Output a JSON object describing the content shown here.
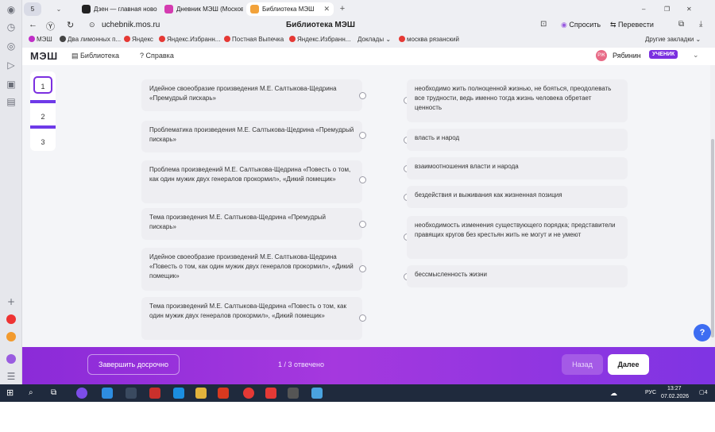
{
  "browser": {
    "tabs": [
      {
        "label": "5",
        "color": "#5b6bd6"
      },
      {
        "label": "Дзен — главная новостей",
        "color": "#222222"
      },
      {
        "label": "Дневник МЭШ (Москов...",
        "color": "#d43bb0"
      },
      {
        "label": "Библиотека МЭШ",
        "color": "#f2a23a"
      }
    ],
    "url": "uchebnik.mos.ru",
    "page_title": "Библиотека МЭШ",
    "actions": {
      "ask": "Спросить",
      "translate": "Перевести"
    },
    "bookmarks": [
      {
        "label": "МЭШ",
        "color": "#c02fc7"
      },
      {
        "label": "Два лимонных п...",
        "color": "#444444"
      },
      {
        "label": "Яндекс",
        "color": "#e53935"
      },
      {
        "label": "Яндекс.Избранн...",
        "color": "#e53935"
      },
      {
        "label": "Постная Выпечка",
        "color": "#e53935"
      },
      {
        "label": "Яндекс.Избранн...",
        "color": "#e53935"
      },
      {
        "label": "Доклады",
        "color": "#777777"
      },
      {
        "label": "москва рязанский",
        "color": "#e53935"
      }
    ],
    "other_bookmarks": "Другие закладки"
  },
  "header": {
    "logo": "МЭШ",
    "nav": [
      "Библиотека",
      "Справка"
    ],
    "avatar_initials": "РЖ",
    "username": "Рябинин",
    "role": "УЧЕНИК"
  },
  "stepper": {
    "steps": [
      "1",
      "2",
      "3"
    ],
    "current": 1
  },
  "left_items": [
    "Идейное своеобразие произведения М.Е. Салтыкова-Щедрина «Премудрый пискарь»",
    "Проблематика произведения М.Е. Салтыкова-Щедрина «Премудрый пискарь»",
    "Проблема произведений М.Е. Салтыкова-Щедрина «Повесть о том, как один мужик двух генералов прокормил», «Дикий помещик»",
    "Тема произведения М.Е. Салтыкова-Щедрина «Премудрый пискарь»",
    "Идейное своеобразие произведений М.Е. Салтыкова-Щедрина «Повесть о том, как один мужик двух генералов прокормил», «Дикий помещик»",
    "Тема произведений М.Е. Салтыкова-Щедрина «Повесть о том, как один мужик двух генералов прокормил», «Дикий помещик»"
  ],
  "right_items": [
    "необходимо жить полноценной жизнью, не бояться, преодолевать все трудности, ведь именно тогда жизнь человека обретает ценность",
    "власть и народ",
    "взаимоотношения власти и народа",
    "бездействия и выживания как жизненная позиция",
    "необходимость изменения существующего порядка; представители правящих кругов без крестьян жить не могут и не умеют",
    "бессмысленность жизни"
  ],
  "footer": {
    "finish_label": "Завершить досрочно",
    "answered": "1 / 3 отвечено",
    "back_label": "Назад",
    "next_label": "Далее"
  },
  "taskbar": {
    "time": "13:27",
    "date": "07.02.2026",
    "lang": "РУС",
    "notif": "4"
  },
  "colors": {
    "accent": "#7b2fe0",
    "footer_start": "#8b2bd8",
    "help": "#3d6df2"
  }
}
